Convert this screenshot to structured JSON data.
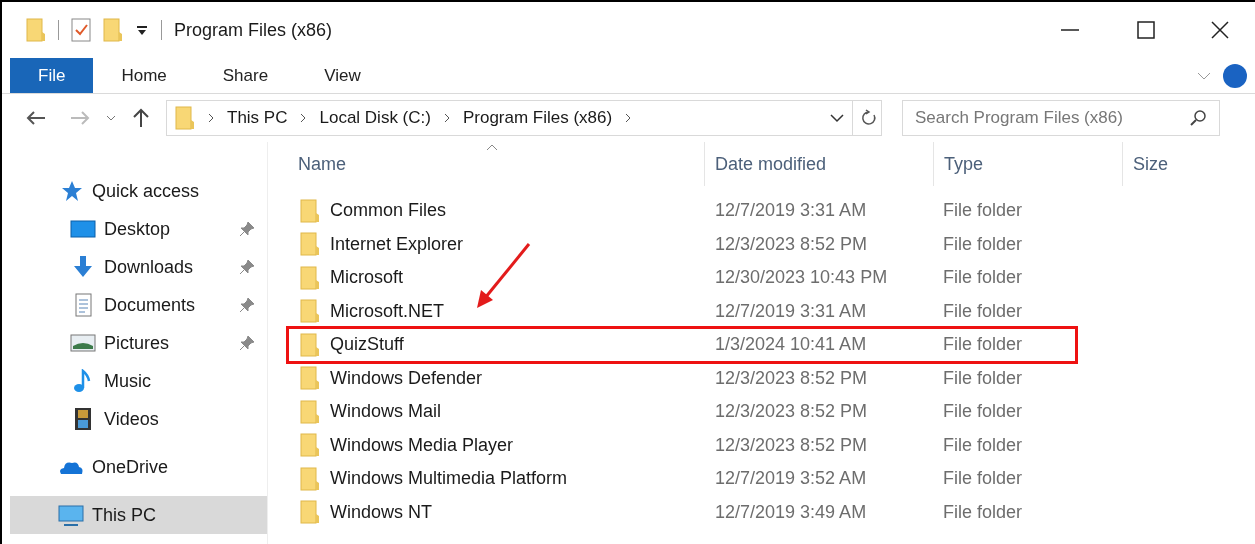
{
  "window": {
    "title": "Program Files (x86)"
  },
  "ribbon_tabs": [
    {
      "label": "File",
      "selected": true
    },
    {
      "label": "Home",
      "selected": false
    },
    {
      "label": "Share",
      "selected": false
    },
    {
      "label": "View",
      "selected": false
    }
  ],
  "address_bar": {
    "crumbs": [
      "This PC",
      "Local Disk (C:)",
      "Program Files (x86)"
    ]
  },
  "search": {
    "placeholder": "Search Program Files (x86)"
  },
  "sidebar": {
    "items": [
      {
        "label": "Quick access",
        "kind": "quick",
        "pinned": false,
        "selected": false,
        "children": [
          {
            "label": "Desktop",
            "kind": "desktop",
            "pinned": true,
            "selected": false
          },
          {
            "label": "Downloads",
            "kind": "downloads",
            "pinned": true,
            "selected": false
          },
          {
            "label": "Documents",
            "kind": "documents",
            "pinned": true,
            "selected": false
          },
          {
            "label": "Pictures",
            "kind": "pictures",
            "pinned": true,
            "selected": false
          },
          {
            "label": "Music",
            "kind": "music",
            "pinned": false,
            "selected": false
          },
          {
            "label": "Videos",
            "kind": "videos",
            "pinned": false,
            "selected": false
          }
        ]
      },
      {
        "label": "OneDrive",
        "kind": "onedrive",
        "pinned": false,
        "selected": false
      },
      {
        "label": "This PC",
        "kind": "pc",
        "pinned": false,
        "selected": true
      }
    ]
  },
  "table": {
    "columns": [
      "Name",
      "Date modified",
      "Type",
      "Size"
    ],
    "rows": [
      {
        "name": "Common Files",
        "date": "12/7/2019 3:31 AM",
        "type": "File folder",
        "annotated": false
      },
      {
        "name": "Internet Explorer",
        "date": "12/3/2023 8:52 PM",
        "type": "File folder",
        "annotated": false
      },
      {
        "name": "Microsoft",
        "date": "12/30/2023 10:43 PM",
        "type": "File folder",
        "annotated": false
      },
      {
        "name": "Microsoft.NET",
        "date": "12/7/2019 3:31 AM",
        "type": "File folder",
        "annotated": false
      },
      {
        "name": "QuizStuff",
        "date": "1/3/2024 10:41 AM",
        "type": "File folder",
        "annotated": true
      },
      {
        "name": "Windows Defender",
        "date": "12/3/2023 8:52 PM",
        "type": "File folder",
        "annotated": false
      },
      {
        "name": "Windows Mail",
        "date": "12/3/2023 8:52 PM",
        "type": "File folder",
        "annotated": false
      },
      {
        "name": "Windows Media Player",
        "date": "12/3/2023 8:52 PM",
        "type": "File folder",
        "annotated": false
      },
      {
        "name": "Windows Multimedia Platform",
        "date": "12/7/2019 3:52 AM",
        "type": "File folder",
        "annotated": false
      },
      {
        "name": "Windows NT",
        "date": "12/7/2019 3:49 AM",
        "type": "File folder",
        "annotated": false
      }
    ]
  }
}
